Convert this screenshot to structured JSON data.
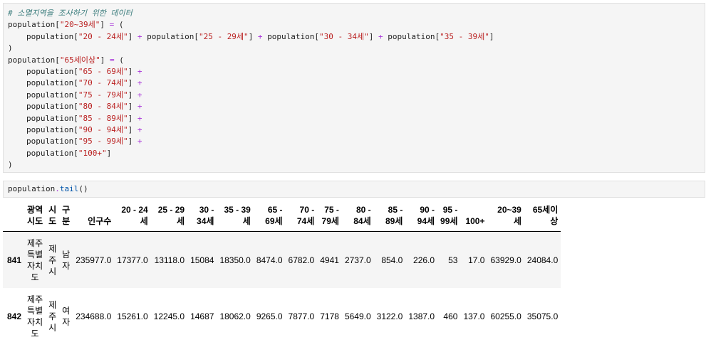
{
  "cell1": {
    "comment": "# 소멸지역을 조사하기 위한 데이터",
    "var": "population",
    "lb": "[",
    "rb": "]",
    "eq": " = ",
    "paren_open": "(",
    "paren_close": ")",
    "plus": " + ",
    "key_2039": "\"20~39세\"",
    "key_65": "\"65세이상\"",
    "keys_2039": [
      "\"20 - 24세\"",
      "\"25 - 29세\"",
      "\"30 - 34세\"",
      "\"35 - 39세\""
    ],
    "keys_65": [
      "\"65 - 69세\"",
      "\"70 - 74세\"",
      "\"75 - 79세\"",
      "\"80 - 84세\"",
      "\"85 - 89세\"",
      "\"90 - 94세\"",
      "\"95 - 99세\"",
      "\"100+\""
    ]
  },
  "cell2": {
    "obj": "population",
    "dot": ".",
    "method": "tail",
    "call": "()"
  },
  "table": {
    "columns": [
      "",
      "광역\n시도",
      "시\n도",
      "구\n분",
      "인구수",
      "20 - 24\n세",
      "25 - 29\n세",
      "30 -\n34세",
      "35 - 39\n세",
      "65 -\n69세",
      "70 -\n74세",
      "75 -\n79세",
      "80 -\n84세",
      "85 -\n89세",
      "90 -\n94세",
      "95 -\n99세",
      "100+",
      "20~39\n세",
      "65세이\n상"
    ],
    "rows": [
      [
        "841",
        "제주\n특별\n자치\n도",
        "제\n주\n시",
        "남\n자",
        "235977.0",
        "17377.0",
        "13118.0",
        "15084",
        "18350.0",
        "8474.0",
        "6782.0",
        "4941",
        "2737.0",
        "854.0",
        "226.0",
        "53",
        "17.0",
        "63929.0",
        "24084.0"
      ],
      [
        "842",
        "제주\n특별\n자치\n도",
        "제\n주\n시",
        "여\n자",
        "234688.0",
        "15261.0",
        "12245.0",
        "14687",
        "18062.0",
        "9265.0",
        "7877.0",
        "7178",
        "5649.0",
        "3122.0",
        "1387.0",
        "460",
        "137.0",
        "60255.0",
        "35075.0"
      ]
    ]
  }
}
